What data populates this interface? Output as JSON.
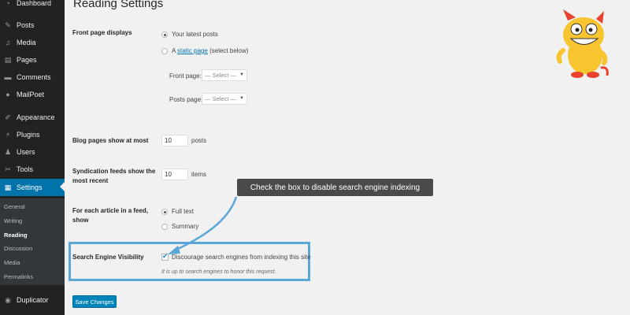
{
  "sidebar": {
    "items": [
      {
        "label": "Dashboard",
        "icon": "dashboard-icon"
      },
      {
        "label": "Posts",
        "icon": "pin-icon"
      },
      {
        "label": "Media",
        "icon": "media-icon"
      },
      {
        "label": "Pages",
        "icon": "pages-icon"
      },
      {
        "label": "Comments",
        "icon": "comments-icon"
      },
      {
        "label": "MailPoet",
        "icon": "mailpoet-icon"
      },
      {
        "label": "Appearance",
        "icon": "brush-icon"
      },
      {
        "label": "Plugins",
        "icon": "plug-icon"
      },
      {
        "label": "Users",
        "icon": "users-icon"
      },
      {
        "label": "Tools",
        "icon": "wrench-icon"
      },
      {
        "label": "Settings",
        "icon": "settings-icon"
      },
      {
        "label": "Duplicator",
        "icon": "duplicator-icon"
      }
    ],
    "submenu": [
      "General",
      "Writing",
      "Reading",
      "Discussion",
      "Media",
      "Permalinks"
    ]
  },
  "page": {
    "title": "Reading Settings",
    "front_page": {
      "label": "Front page displays",
      "option_latest": "Your latest posts",
      "option_static_prefix": "A",
      "option_static_link": "static page",
      "option_static_suffix": "(select below)",
      "front_page_label": "Front page:",
      "posts_page_label": "Posts page:",
      "select_placeholder": "— Select —"
    },
    "blog_pages": {
      "label": "Blog pages show at most",
      "value": "10",
      "unit": "posts"
    },
    "syndication": {
      "label_line1": "Syndication feeds show the",
      "label_line2": "most recent",
      "value": "10",
      "unit": "items"
    },
    "feed_article": {
      "label_line1": "For each article in a feed,",
      "label_line2": "show",
      "option_full": "Full text",
      "option_summary": "Summary"
    },
    "visibility": {
      "label": "Search Engine Visibility",
      "checkbox_label": "Discourage search engines from indexing this site",
      "description": "It is up to search engines to honor this request."
    },
    "save_button": "Save Changes"
  },
  "callout": {
    "text": "Check the box to disable search engine indexing"
  },
  "colors": {
    "sidebar_bg": "#222222",
    "active_accent": "#0073aa",
    "highlight_border": "#5aa6d6",
    "callout_bg": "#4a4a4a",
    "button_bg": "#0085ba"
  }
}
